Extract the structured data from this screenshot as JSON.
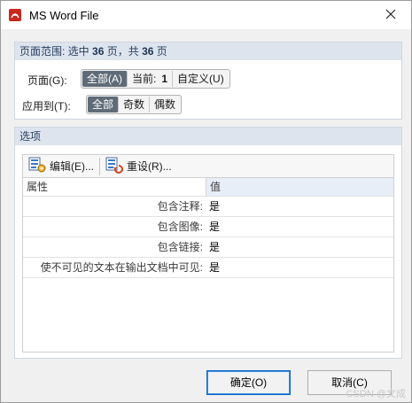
{
  "window": {
    "title": "MS Word File",
    "app_icon": "pdf-app-icon",
    "close_icon": "close-icon"
  },
  "page_range": {
    "header_prefix": "页面范围: 选中",
    "selected_count": "36",
    "header_mid": "页，共",
    "total_count": "36",
    "header_suffix": "页",
    "pages_label": "页面(G):",
    "pages_options": {
      "all": "全部(A)",
      "current_label": "当前:",
      "current_value": "1",
      "custom": "自定义(U)"
    },
    "selected_pages_option": "全部(A)",
    "apply_label": "应用到(T):",
    "apply_options": [
      "全部",
      "奇数",
      "偶数"
    ],
    "selected_apply_option": "全部"
  },
  "options": {
    "header": "选项",
    "toolbar": {
      "edit_label": "编辑(E)...",
      "reset_label": "重设(R)..."
    },
    "columns": {
      "name": "属性",
      "value": "值"
    },
    "rows": [
      {
        "name": "包含注释:",
        "value": "是"
      },
      {
        "name": "包含图像:",
        "value": "是"
      },
      {
        "name": "包含链接:",
        "value": "是"
      },
      {
        "name": "使不可见的文本在输出文档中可见:",
        "value": "是"
      }
    ]
  },
  "footer": {
    "ok_label": "确定(O)",
    "cancel_label": "取消(C)"
  },
  "watermark": "CSDN @文成",
  "colors": {
    "accent_blue": "#0a64c8",
    "selected_segment": "#5f6c78",
    "group_header": "#dde4ee",
    "title_icon_red": "#c8281e"
  }
}
